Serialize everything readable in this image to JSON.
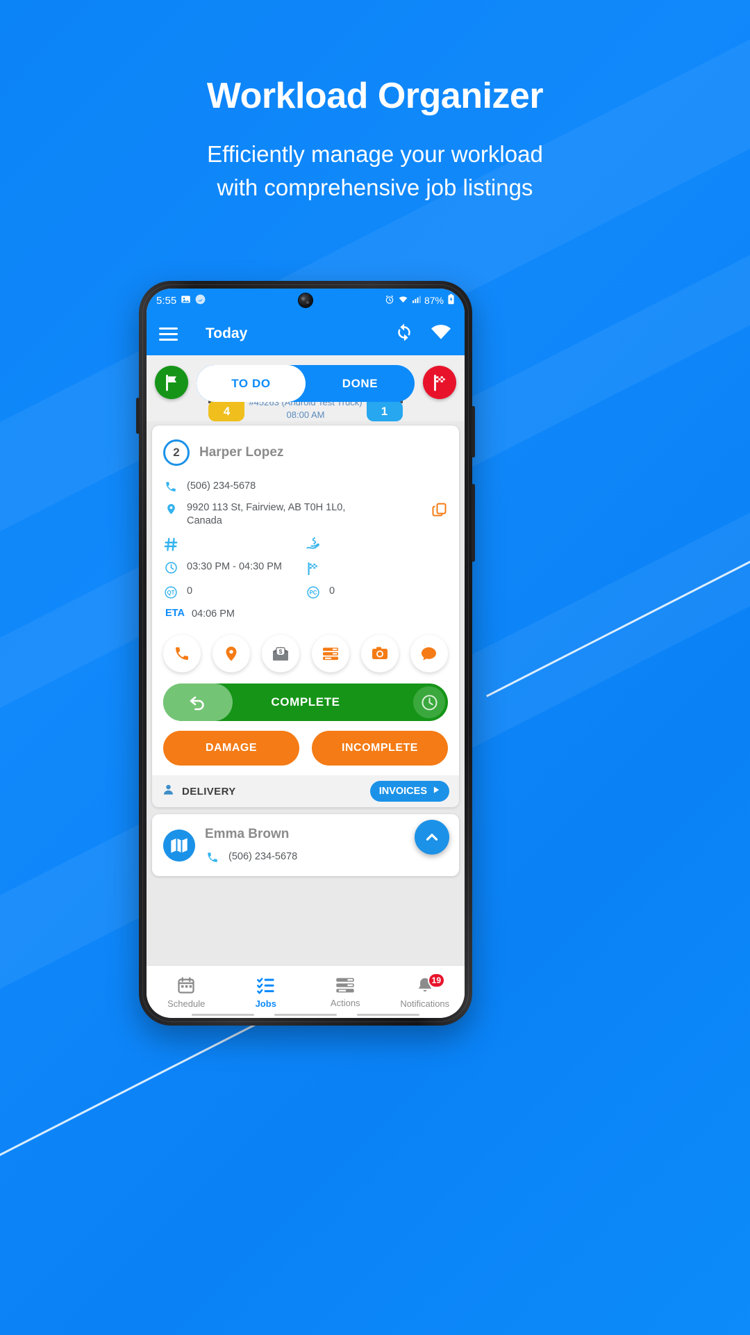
{
  "promo": {
    "headline": "Workload Organizer",
    "subline_1": "Efficiently manage your workload",
    "subline_2": "with comprehensive job listings"
  },
  "status_bar": {
    "time": "5:55",
    "battery": "87%",
    "icons": [
      "image-icon",
      "app-icon",
      "alarm-icon",
      "wifi-icon",
      "signal-icon",
      "battery-charging-icon"
    ]
  },
  "app_bar": {
    "menu": "menu-icon",
    "title": "Today",
    "refresh": "refresh-icon",
    "wifi": "wifi-icon"
  },
  "tabs": {
    "start_flag": "flag-icon",
    "end_flag": "checkered-flag-icon",
    "items": [
      {
        "label": "TO DO",
        "active": true
      },
      {
        "label": "DONE",
        "active": false
      }
    ]
  },
  "route_strip": {
    "left_chip": "4",
    "right_chip": "1",
    "title": "#45263 (Android Test Truck)",
    "time": "08:00 AM"
  },
  "job_card": {
    "sequence": "2",
    "customer": "Harper Lopez",
    "phone": "(506) 234-5678",
    "address": "9920 113 St, Fairview, AB T0H 1L0, Canada",
    "copy_icon": "copy-icon",
    "ref_icon": "hash-icon",
    "ref_value": "",
    "cod_icon": "cash-hand-icon",
    "cod_value": "",
    "time_icon": "clock-icon",
    "time_window": "03:30 PM - 04:30 PM",
    "finish_icon": "checkered-flag-icon",
    "qt_label": "QT",
    "qt_value": "0",
    "pc_label": "PC",
    "pc_value": "0",
    "eta_label": "ETA",
    "eta_value": "04:06 PM",
    "action_icons": [
      "phone-icon",
      "location-pin-icon",
      "envelope-money-icon",
      "list-lines-icon",
      "camera-icon",
      "chat-bubble-icon"
    ],
    "complete_button": "COMPLETE",
    "undo_icon": "undo-arrow-icon",
    "postpone_icon": "clock-icon",
    "damage_button": "DAMAGE",
    "incomplete_button": "INCOMPLETE",
    "footer_icon": "person-icon",
    "footer_label": "DELIVERY",
    "invoices_button": "INVOICES",
    "invoices_arrow": "play-triangle-icon"
  },
  "job_card_2": {
    "map_icon": "map-icon",
    "customer": "Emma Brown",
    "phone_icon": "phone-icon",
    "phone": "(506) 234-5678",
    "fab_icon": "chevron-up-icon"
  },
  "bottom_nav": {
    "items": [
      {
        "label": "Schedule",
        "icon": "calendar-icon",
        "active": false,
        "badge": ""
      },
      {
        "label": "Jobs",
        "icon": "checklist-icon",
        "active": true,
        "badge": ""
      },
      {
        "label": "Actions",
        "icon": "lines-icon",
        "active": false,
        "badge": ""
      },
      {
        "label": "Notifications",
        "icon": "bell-icon",
        "active": false,
        "badge": "19"
      }
    ]
  },
  "colors": {
    "brand_blue": "#0d8bfa",
    "accent_orange": "#f47b15",
    "success_green": "#159417",
    "danger_red": "#e8132b"
  }
}
